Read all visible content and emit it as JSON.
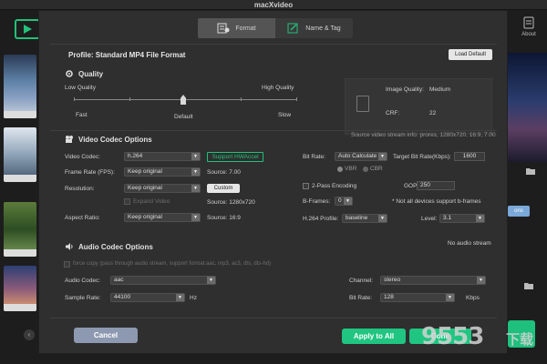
{
  "window": {
    "title": "macXvideo"
  },
  "topbar": {
    "about_label": "About"
  },
  "tabs": [
    {
      "label": "Format",
      "icon": "format-icon"
    },
    {
      "label": "Name & Tag",
      "icon": "name-tag-icon"
    }
  ],
  "profile": {
    "text": "Profile:  Standard MP4 File Format",
    "load_default": "Load Default"
  },
  "quality": {
    "header": "Quality",
    "low_label": "Low Quality",
    "high_label": "High Quality",
    "fast_label": "Fast",
    "default_label": "Default",
    "slow_label": "Slow",
    "image_quality_label": "Image Quality:",
    "image_quality_value": "Medium",
    "crf_label": "CRF:",
    "crf_value": "22"
  },
  "video": {
    "header": "Video Codec Options",
    "source_info": "Source video stream info: prores, 1280x720, 16:9, 7.00",
    "codec_label": "Video Codec:",
    "codec_value": "h.264",
    "hw_label": "Support HWAccel",
    "fps_label": "Frame Rate (FPS):",
    "fps_value": "Keep original",
    "fps_source": "Source: 7.00",
    "res_label": "Resolution:",
    "res_value": "Keep original",
    "custom_label": "Custom",
    "res_source": "Source: 1280x720",
    "expand_label": "Expand Video",
    "aspect_label": "Aspect Ratio:",
    "aspect_value": "Keep original",
    "aspect_source": "Source: 16:9",
    "bitrate_label": "Bit Rate:",
    "bitrate_value": "Auto Calculate",
    "target_label": "Target Bit Rate(Kbps):",
    "target_value": "1600",
    "vbr_label": "VBR",
    "cbr_label": "CBR",
    "twopass_label": "2-Pass Encoding",
    "gop_label": "GOP:",
    "gop_value": "250",
    "bframes_label": "B-Frames:",
    "bframes_value": "0",
    "bframes_note": "* Not all devices support b-frames",
    "profile_label": "H.264 Profile:",
    "profile_value": "baseline",
    "level_label": "Level:",
    "level_value": "3.1"
  },
  "audio": {
    "header": "Audio Codec Options",
    "no_stream": "No audio stream",
    "force_copy": "force copy (pass through audio stream, support format:aac, mp3, ac3, dts, dts-hd)",
    "codec_label": "Audio Codec:",
    "codec_value": "aac",
    "channel_label": "Channel:",
    "channel_value": "stereo",
    "samplerate_label": "Sample Rate:",
    "samplerate_value": "44100",
    "samplerate_unit": "Hz",
    "bitrate_label": "Bit Rate:",
    "bitrate_value": "128",
    "bitrate_unit": "Kbps"
  },
  "footer": {
    "cancel": "Cancel",
    "apply_all": "Apply to All",
    "done": "Done"
  },
  "watermark": {
    "text": "9553",
    "sub": "下载"
  },
  "colors": {
    "accent_green": "#20c581",
    "cancel_blue": "#8d99b0"
  }
}
